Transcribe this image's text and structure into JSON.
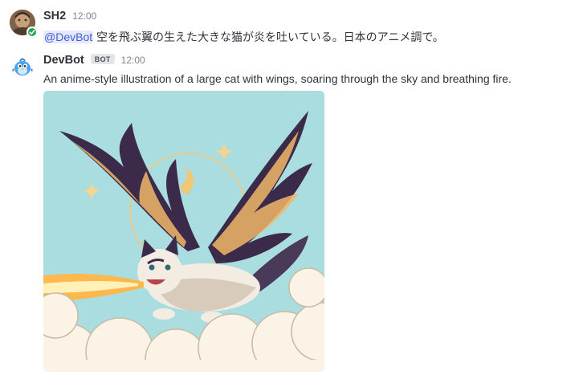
{
  "messages": [
    {
      "author": "SH2",
      "timestamp": "12:00",
      "mention": "@DevBot",
      "text": " 空を飛ぶ翼の生えた大きな猫が炎を吐いている。日本のアニメ調で。"
    },
    {
      "author": "DevBot",
      "badge": "BOT",
      "timestamp": "12:00",
      "text": "An anime-style illustration of a large cat with wings, soaring through the sky and breathing fire."
    }
  ],
  "colors": {
    "online": "#23a559",
    "mention_text": "#3f5dd6",
    "mention_bg": "#e6e9fd",
    "sky": "#a9dde0",
    "wing_purple": "#3b2a4a",
    "wing_orange": "#f2b768",
    "fire": "#ffb84d"
  },
  "icons": {
    "online_status": "checkmark-icon",
    "bot_avatar": "bluebird-icon"
  }
}
